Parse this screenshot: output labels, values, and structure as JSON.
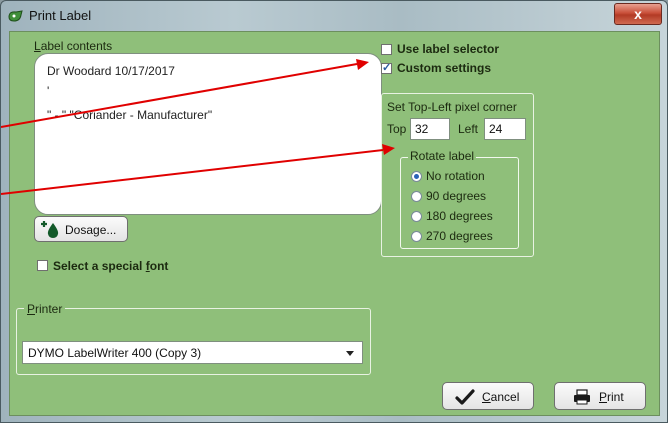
{
  "window": {
    "title": "Print Label",
    "close_glyph": "x"
  },
  "label_contents": {
    "caption_mnemonic": "L",
    "caption_rest": "abel contents",
    "lines": [
      "Dr Woodard 10/17/2017",
      "'",
      "\" - \" \"Coriander - Manufacturer\""
    ]
  },
  "dosage_button": {
    "label": "Dosage...",
    "icon": "drop-plus-icon"
  },
  "special_font": {
    "label_pre": "Select a special ",
    "mnemonic": "f",
    "label_post": "ont",
    "checked": false
  },
  "options": {
    "use_label_selector": {
      "label": "Use label selector",
      "checked": false
    },
    "custom_settings": {
      "label": "Custom settings",
      "checked": true
    }
  },
  "pixel_corner": {
    "caption": "Set Top-Left pixel corner",
    "top_label": "Top",
    "top_value": "32",
    "left_label": "Left",
    "left_value": "24"
  },
  "rotate": {
    "caption": "Rotate label",
    "options": [
      "No rotation",
      "90 degrees",
      "180 degrees",
      "270 degrees"
    ],
    "selected": "No rotation"
  },
  "printer": {
    "caption_mnemonic": "P",
    "caption_rest": "rinter",
    "selected": "DYMO LabelWriter 400 (Copy 3)"
  },
  "buttons": {
    "cancel": {
      "mnemonic": "C",
      "rest": "ancel",
      "icon": "checkmark-icon"
    },
    "print": {
      "mnemonic": "P",
      "rest": "rint",
      "icon": "printer-icon"
    }
  },
  "colors": {
    "dialog_bg": "#8fbf7a",
    "annotation_arrow": "#e00000",
    "close_button": "#c9503a"
  }
}
